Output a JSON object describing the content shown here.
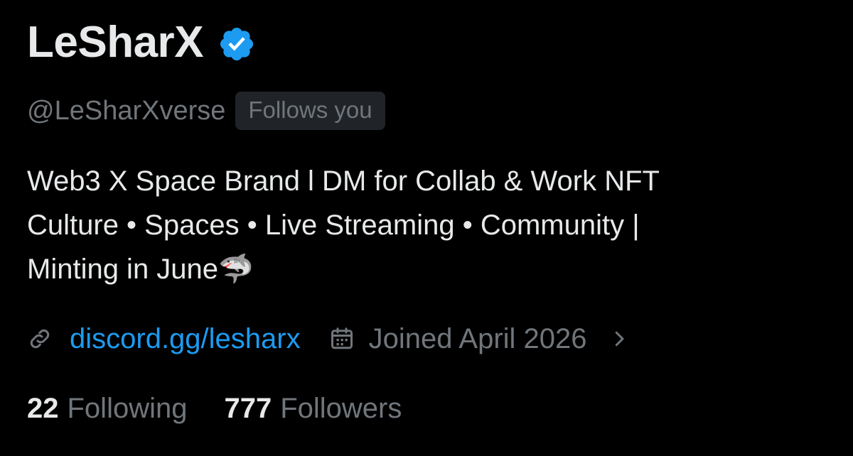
{
  "profile": {
    "display_name": "LeSharX",
    "verified_badge_icon": "verified-badge-icon",
    "handle": "@LeSharXverse",
    "follows_you_label": "Follows you",
    "bio": {
      "line1": "Web3 X Space Brand l DM for Collab & Work NFT",
      "line2": "Culture • Spaces • Live Streaming • Community |",
      "line3": "Minting in June🦈"
    },
    "link": {
      "icon": "link-icon",
      "text": "discord.gg/lesharx"
    },
    "joined": {
      "icon": "calendar-icon",
      "text": "Joined April 2026",
      "chevron_icon": "chevron-right-icon"
    },
    "stats": {
      "following_count": "22",
      "following_label": "Following",
      "followers_count": "777",
      "followers_label": "Followers"
    }
  },
  "colors": {
    "background": "#000000",
    "primary_text": "#e7e9ea",
    "secondary_text": "#71767b",
    "accent": "#1d9bf0",
    "badge_bg": "#202327"
  }
}
